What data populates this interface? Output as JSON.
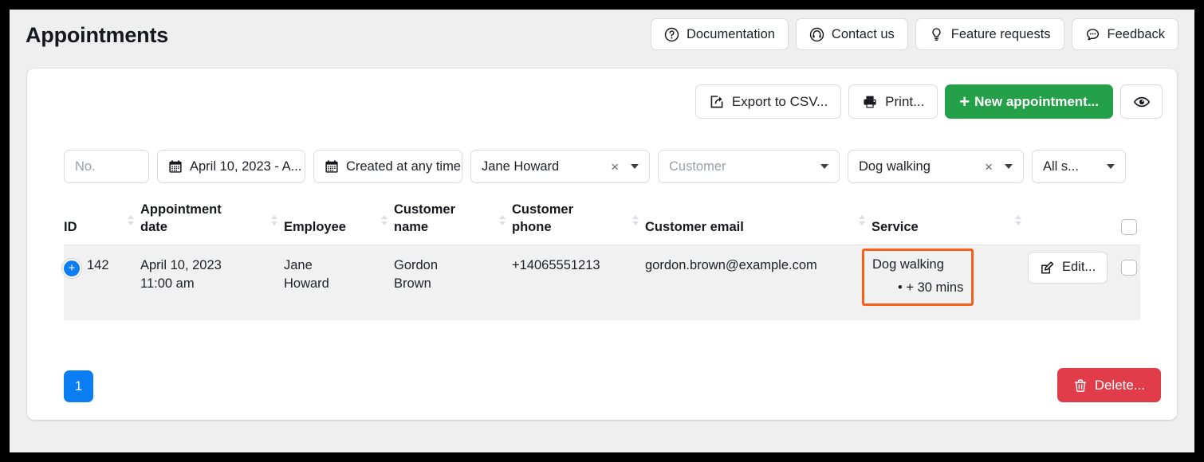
{
  "header": {
    "title": "Appointments",
    "actions": [
      {
        "label": "Documentation",
        "icon": "question-circle-icon"
      },
      {
        "label": "Contact us",
        "icon": "headset-icon"
      },
      {
        "label": "Feature requests",
        "icon": "lightbulb-icon"
      },
      {
        "label": "Feedback",
        "icon": "comment-icon"
      }
    ]
  },
  "toolbar": {
    "export_label": "Export to CSV...",
    "print_label": "Print...",
    "new_label": "New appointment...",
    "new_plus": "+",
    "preview_icon": "eye-icon"
  },
  "filters": {
    "no_placeholder": "No.",
    "no_value": "",
    "date_range": "April 10, 2023 - A...",
    "created": "Created at any time",
    "employee": "Jane Howard",
    "customer_placeholder": "Customer",
    "customer_value": "",
    "service": "Dog walking",
    "status": "All s...",
    "clear_glyph": "×"
  },
  "table": {
    "columns": [
      {
        "label": "ID",
        "sortable": true
      },
      {
        "label": "Appointment date",
        "sortable": true
      },
      {
        "label": "Employee",
        "sortable": true
      },
      {
        "label": "Customer name",
        "sortable": true
      },
      {
        "label": "Customer phone",
        "sortable": true
      },
      {
        "label": "Customer email",
        "sortable": true
      },
      {
        "label": "Service",
        "sortable": true
      }
    ],
    "rows": [
      {
        "expand_glyph": "+",
        "id": "142",
        "date": "April 10, 2023",
        "time": "11:00 am",
        "employee_line1": "Jane",
        "employee_line2": "Howard",
        "customer_line1": "Gordon",
        "customer_line2": "Brown",
        "phone": "+14065551213",
        "email": "gordon.brown@example.com",
        "service": "Dog walking",
        "service_extra": "• + 30 mins",
        "service_highlighted": true,
        "edit_label": "Edit...",
        "selected": false
      }
    ]
  },
  "footer": {
    "page": "1",
    "delete_label": "Delete..."
  },
  "colors": {
    "accent_green": "#24a148",
    "accent_blue": "#0b7ef4",
    "danger_red": "#e13c4a",
    "highlight_orange": "#f4601a"
  }
}
